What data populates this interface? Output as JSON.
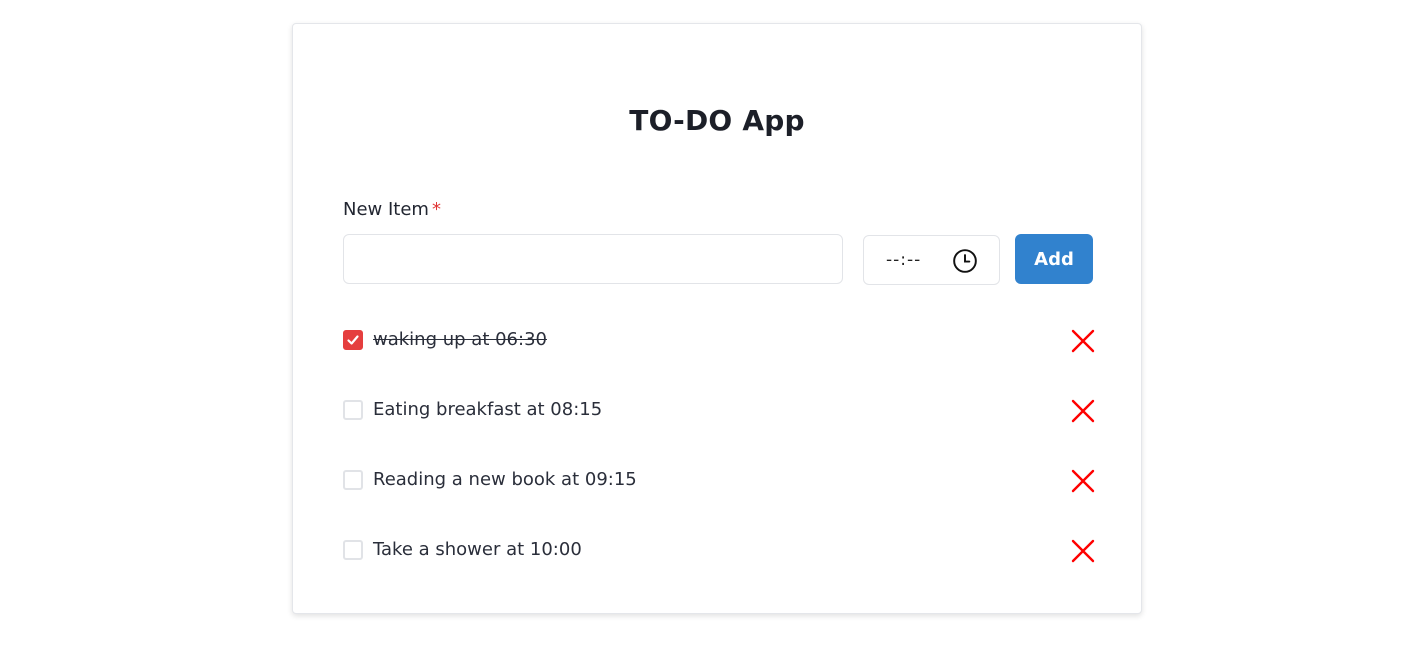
{
  "app": {
    "title": "TO-DO App"
  },
  "form": {
    "label": "New Item",
    "required_mark": "*",
    "text_value": "",
    "time_placeholder": "--:--",
    "add_label": "Add"
  },
  "todos": [
    {
      "text": "waking up at 06:30",
      "done": true
    },
    {
      "text": "Eating breakfast at 08:15",
      "done": false
    },
    {
      "text": "Reading a new book at 09:15",
      "done": false
    },
    {
      "text": "Take a shower at 10:00",
      "done": false
    }
  ],
  "colors": {
    "accent": "#3182ce",
    "checked": "#e53e3e",
    "delete": "#ff0000",
    "required": "#e03535"
  }
}
